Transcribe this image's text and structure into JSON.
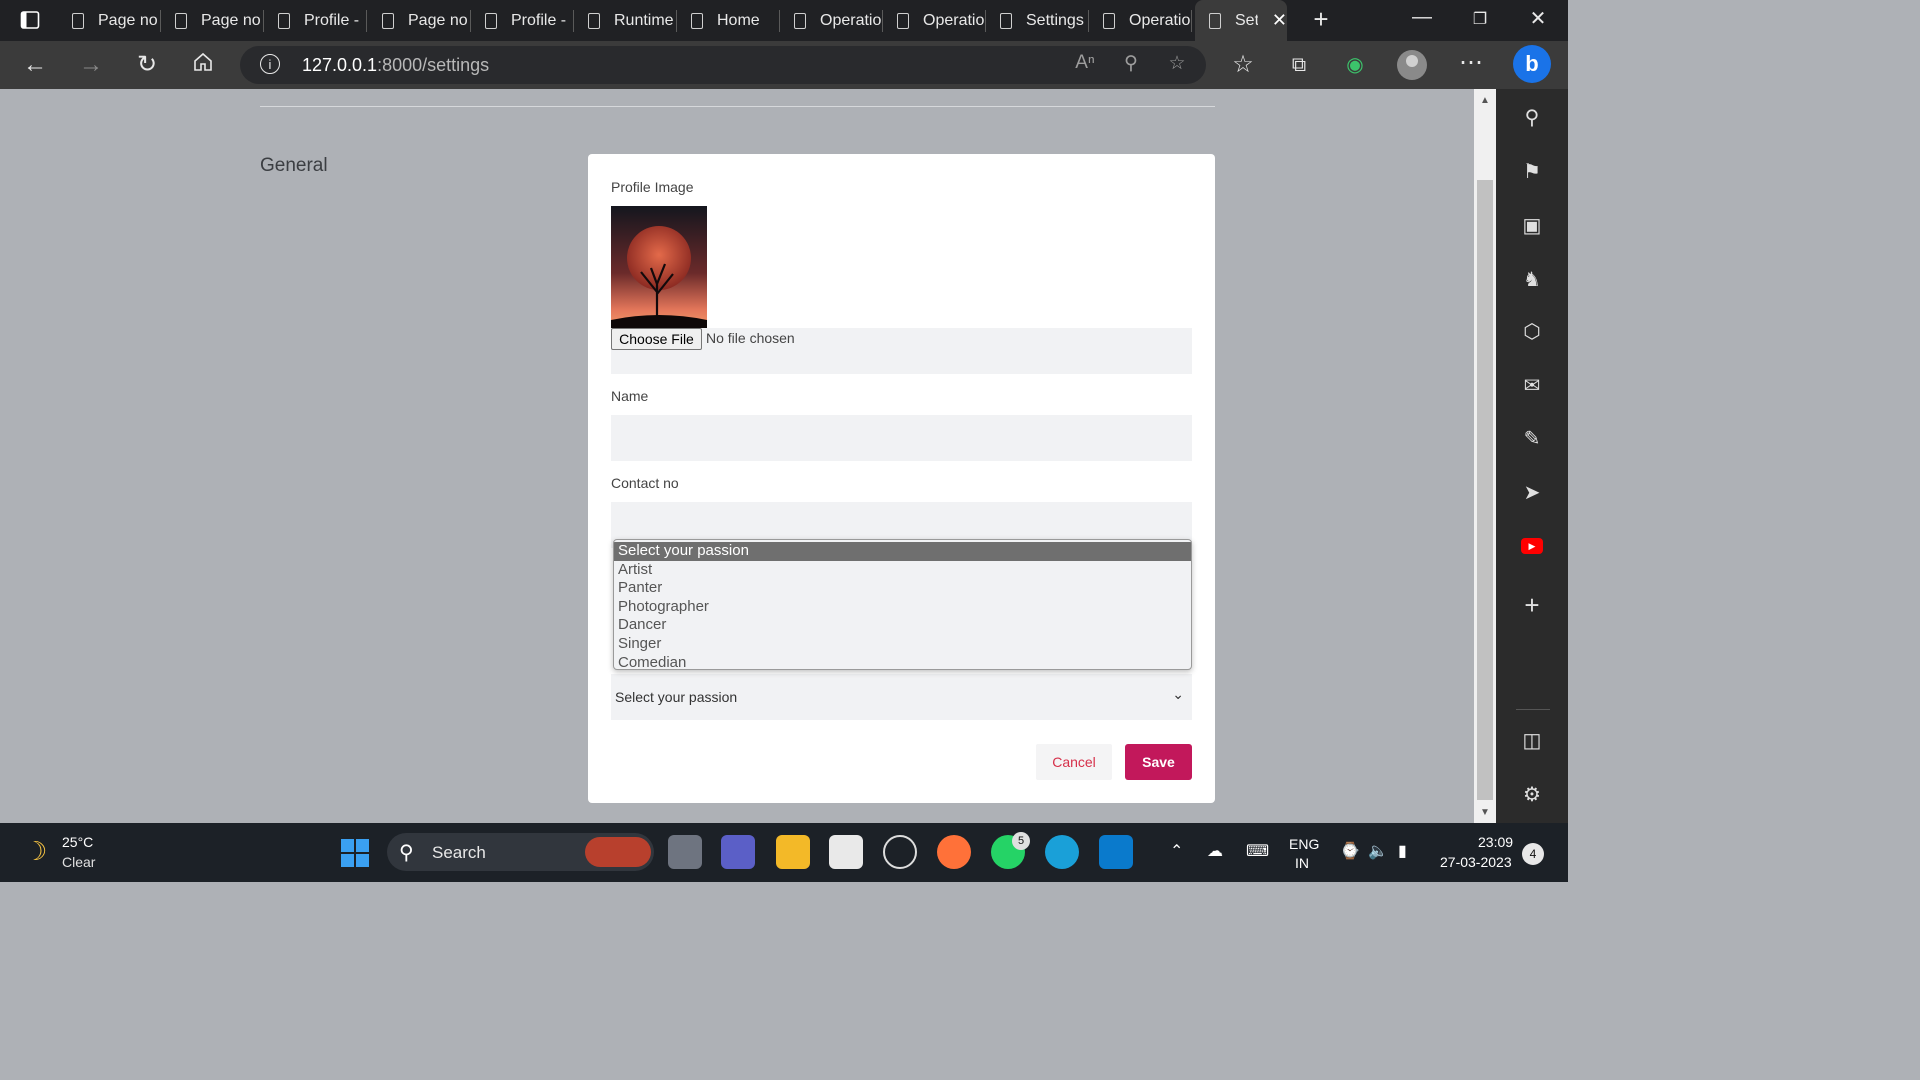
{
  "browser": {
    "tabs": [
      {
        "title": "Page no"
      },
      {
        "title": "Page no"
      },
      {
        "title": "Profile -"
      },
      {
        "title": "Page no"
      },
      {
        "title": "Profile -"
      },
      {
        "title": "Runtime"
      },
      {
        "title": "Home"
      },
      {
        "title": "Operatio"
      },
      {
        "title": "Operatio"
      },
      {
        "title": "Settings"
      },
      {
        "title": "Operatio"
      },
      {
        "title": "Sett"
      }
    ],
    "active_tab_index": 11,
    "url_host": "127.0.0.1",
    "url_rest": ":8000/settings"
  },
  "page": {
    "section_title": "General",
    "form": {
      "profile_image_label": "Profile Image",
      "choose_file_label": "Choose File",
      "file_status": "No file chosen",
      "name_label": "Name",
      "name_value": "",
      "contact_label": "Contact no",
      "contact_value": "",
      "passion_select_value": "Select your passion",
      "passion_options": [
        "Select your passion",
        "Artist",
        "Panter",
        "Photographer",
        "Dancer",
        "Singer",
        "Comedian"
      ],
      "passion_selected_index": 0,
      "cancel_label": "Cancel",
      "save_label": "Save"
    }
  },
  "colors": {
    "save_button": "#c2185b",
    "cancel_text": "#d6304a",
    "page_background": "#aeb1b6"
  },
  "taskbar": {
    "weather_temp": "25°C",
    "weather_condition": "Clear",
    "search_label": "Search",
    "whatsapp_badge": "5",
    "language_line1": "ENG",
    "language_line2": "IN",
    "time": "23:09",
    "date": "27-03-2023",
    "notification_count": "4"
  }
}
